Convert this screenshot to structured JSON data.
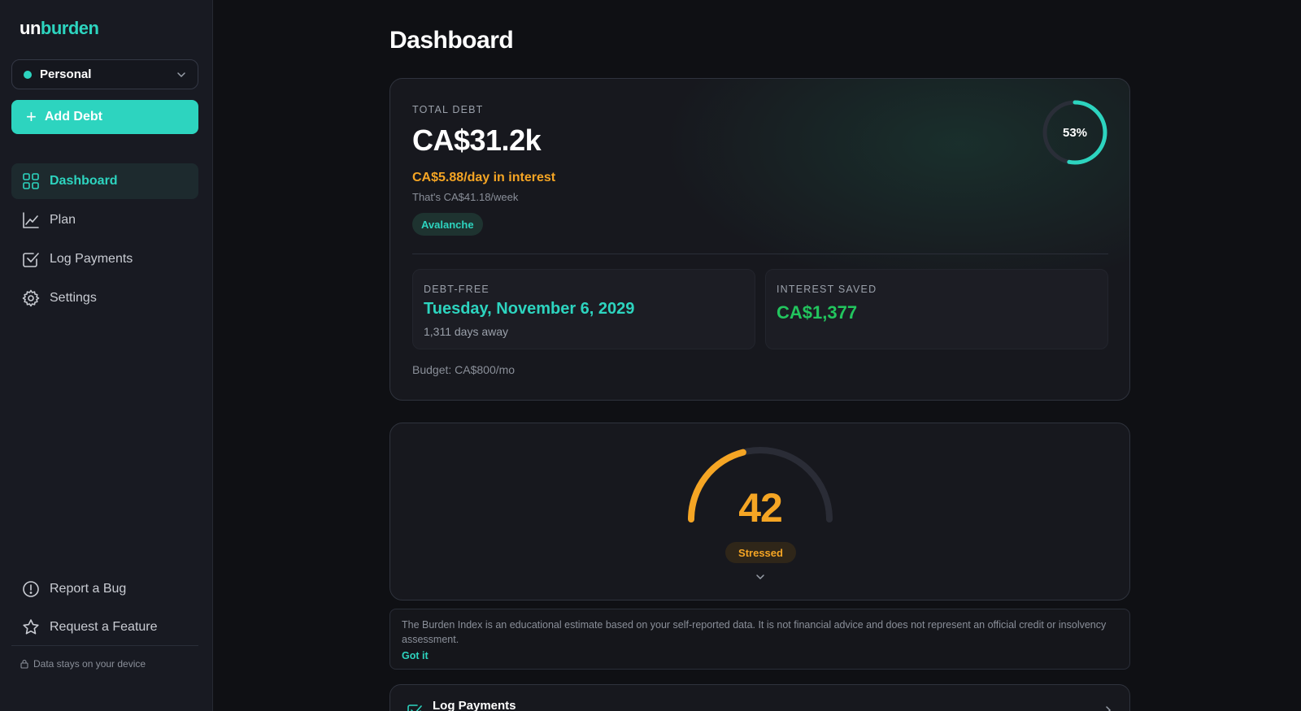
{
  "logo": {
    "part1": "un",
    "part2": "burden"
  },
  "workspace": {
    "label": "Personal"
  },
  "add_debt": {
    "label": "Add Debt"
  },
  "nav": [
    {
      "label": "Dashboard",
      "icon": "grid-icon"
    },
    {
      "label": "Plan",
      "icon": "line-chart-icon"
    },
    {
      "label": "Log Payments",
      "icon": "checkbox-icon"
    },
    {
      "label": "Settings",
      "icon": "gear-icon"
    }
  ],
  "footer_nav": [
    {
      "label": "Report a Bug",
      "icon": "alert-circle-icon"
    },
    {
      "label": "Request a Feature",
      "icon": "star-icon"
    }
  ],
  "device_note": "Data stays on your device",
  "page_title": "Dashboard",
  "total": {
    "label": "TOTAL DEBT",
    "value": "CA$31.2k",
    "interest_day": "CA$5.88/day in interest",
    "interest_week": "That's CA$41.18/week",
    "strategy": "Avalanche",
    "progress_percent": 53,
    "progress_text": "53%"
  },
  "debt_free": {
    "label": "DEBT-FREE",
    "date": "Tuesday, November 6, 2029",
    "days_away": "1,311 days away"
  },
  "interest_saved": {
    "label": "INTEREST SAVED",
    "value": "CA$1,377"
  },
  "budget": "Budget: CA$800/mo",
  "burden_index": {
    "value": "42",
    "status": "Stressed",
    "max": 100
  },
  "disclaimer": {
    "text": "The Burden Index is an educational estimate based on your self-reported data. It is not financial advice and does not represent an official credit or insolvency assessment.",
    "action": "Got it"
  },
  "log_card": {
    "title": "Log Payments"
  },
  "colors": {
    "accent": "#2dd4bf",
    "warning": "#f5a524",
    "success": "#22c55e",
    "background": "#0f1014"
  }
}
